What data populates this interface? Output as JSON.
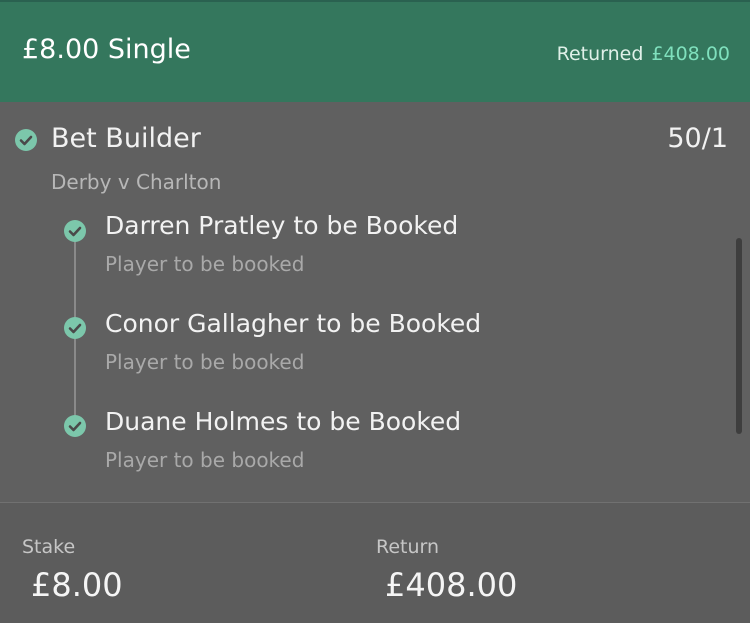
{
  "header": {
    "title": "£8.00 Single",
    "returned_label": "Returned",
    "returned_amount": "£408.00"
  },
  "bet_builder": {
    "title": "Bet Builder",
    "odds": "50/1",
    "match": "Derby v Charlton",
    "selections": [
      {
        "title": "Darren Pratley to be Booked",
        "subtitle": "Player to be booked"
      },
      {
        "title": "Conor Gallagher to be Booked",
        "subtitle": "Player to be booked"
      },
      {
        "title": "Duane Holmes to be Booked",
        "subtitle": "Player to be booked"
      }
    ]
  },
  "footer": {
    "stake_label": "Stake",
    "stake_value": "£8.00",
    "return_label": "Return",
    "return_value": "£408.00"
  },
  "colors": {
    "header_bg": "#34775d",
    "accent_green": "#7fe0bd",
    "check_green": "#7cc7ab",
    "panel_bg": "#606060"
  },
  "icons": {
    "check": "check-circle-icon"
  }
}
